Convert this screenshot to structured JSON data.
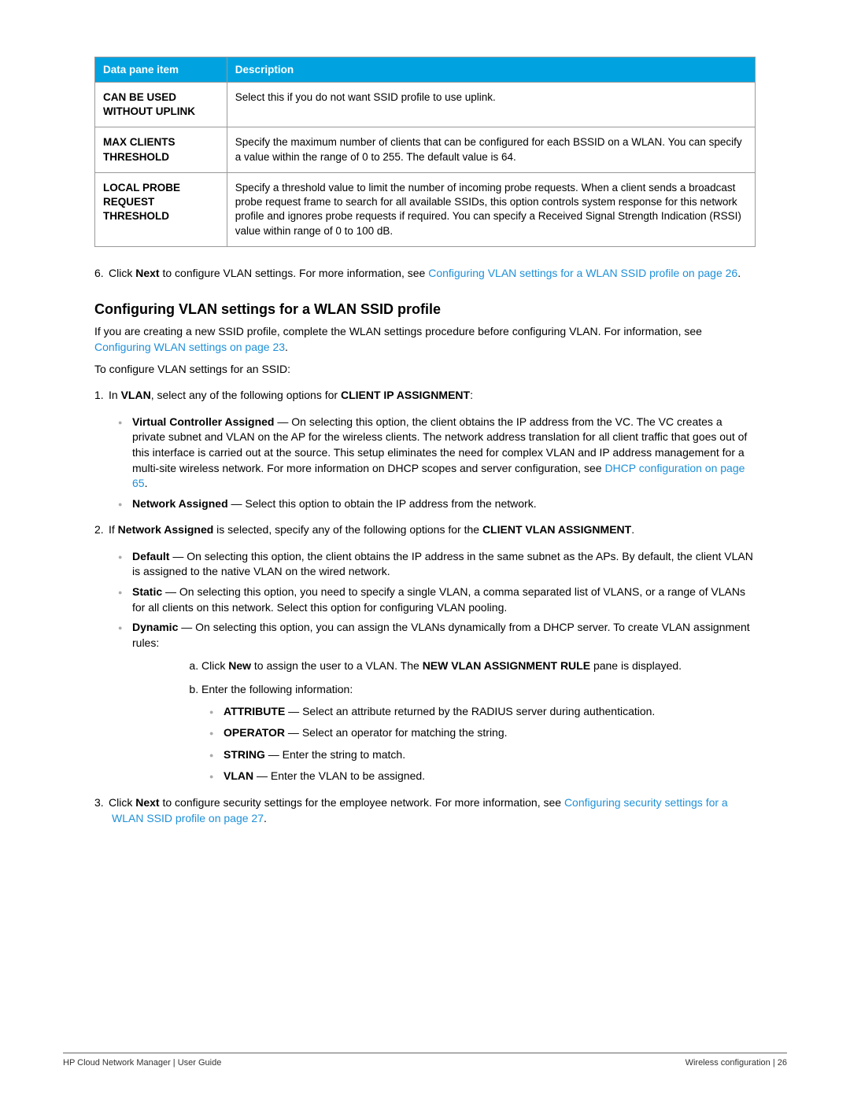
{
  "table": {
    "headers": {
      "c1": "Data pane item",
      "c2": "Description"
    },
    "rows": [
      {
        "label": "CAN BE USED WITHOUT UPLINK",
        "desc": "Select this if you do not want SSID profile to use uplink."
      },
      {
        "label": "MAX CLIENTS THRESHOLD",
        "desc": "Specify the maximum number of clients that can be configured for each BSSID on a WLAN. You can specify a value within the range of 0 to 255. The default value is 64."
      },
      {
        "label": "LOCAL PROBE REQUEST THRESHOLD",
        "desc": "Specify a threshold value to limit the number of incoming probe requests. When a client sends a broadcast probe request frame to search for all available SSIDs, this option controls system response for this network profile and ignores probe requests if required. You can specify a Received Signal Strength Indication (RSSI) value within range of 0 to 100 dB."
      }
    ]
  },
  "step6": {
    "num": "6.",
    "pre": "Click ",
    "bold": "Next",
    "mid": " to configure VLAN settings. For more information, see ",
    "link": "Configuring VLAN settings for a WLAN SSID profile on page 26",
    "post": "."
  },
  "heading": "Configuring VLAN settings for a WLAN SSID profile",
  "intro": {
    "pre": "If you are creating a new SSID profile, complete the WLAN settings procedure before configuring VLAN. For information, see ",
    "link": "Configuring WLAN settings on page 23",
    "post": "."
  },
  "intro2": "To configure VLAN settings for an SSID:",
  "s1": {
    "num": "1.",
    "pre": "In ",
    "b1": "VLAN",
    "mid": ", select any of the following options for ",
    "b2": "CLIENT IP ASSIGNMENT",
    "post": ":"
  },
  "s1b1": {
    "bold": "Virtual Controller Assigned",
    "dash": " — ",
    "text": "On selecting this option, the client obtains the IP address from the VC. The VC creates a private subnet and VLAN on the AP for the wireless clients. The network address translation for all client traffic that goes out of this interface is carried out at the source. This setup eliminates the need for complex VLAN and IP address management for a multi-site wireless network. For more information on DHCP scopes and server configuration, see ",
    "link": "DHCP configuration on page 65",
    "post": "."
  },
  "s1b2": {
    "bold": "Network Assigned",
    "dash": " — ",
    "text": "Select this option to obtain the IP address from the network."
  },
  "s2": {
    "num": "2.",
    "pre": "If ",
    "b1": "Network Assigned",
    "mid": " is selected, specify any of the following options for the ",
    "b2": "CLIENT VLAN ASSIGNMENT",
    "post": "."
  },
  "s2b1": {
    "bold": "Default",
    "dash": " — ",
    "text": "On selecting this option, the client obtains the IP address in the same subnet as the APs. By default, the client VLAN is assigned to the native VLAN on the wired network."
  },
  "s2b2": {
    "bold": "Static",
    "dash": " — ",
    "text": "On selecting this option, you need to specify a single VLAN, a comma separated list of VLANS, or a range of VLANs for all clients on this network. Select this option for configuring VLAN pooling."
  },
  "s2b3": {
    "bold": "Dynamic",
    "dash": " — ",
    "text": "On selecting this option, you can assign the VLANs dynamically from a DHCP server. To create VLAN assignment rules:"
  },
  "suba": {
    "pre": "Click ",
    "b1": "New",
    "mid": " to assign the user to a VLAN. The ",
    "b2": "NEW VLAN ASSIGNMENT RULE",
    "post": " pane is displayed."
  },
  "subb": "Enter the following information:",
  "attr": {
    "bold": "ATTRIBUTE",
    "dash": " — ",
    "text": "Select an attribute returned by the RADIUS server during authentication."
  },
  "oper": {
    "bold": "OPERATOR",
    "dash": " — ",
    "text": "Select an operator for matching the string."
  },
  "str": {
    "bold": "STRING",
    "dash": " — ",
    "text": "Enter the string to match."
  },
  "vlan": {
    "bold": "VLAN",
    "dash": " — ",
    "text": "Enter the VLAN to be assigned."
  },
  "s3": {
    "num": "3.",
    "pre": "Click ",
    "b1": "Next",
    "mid": " to configure security settings for the employee network. For more information, see ",
    "link": "Configuring security settings for a WLAN SSID profile on page 27",
    "post": "."
  },
  "footer": {
    "left": "HP Cloud Network Manager | User Guide",
    "right": "Wireless configuration  |  26"
  }
}
